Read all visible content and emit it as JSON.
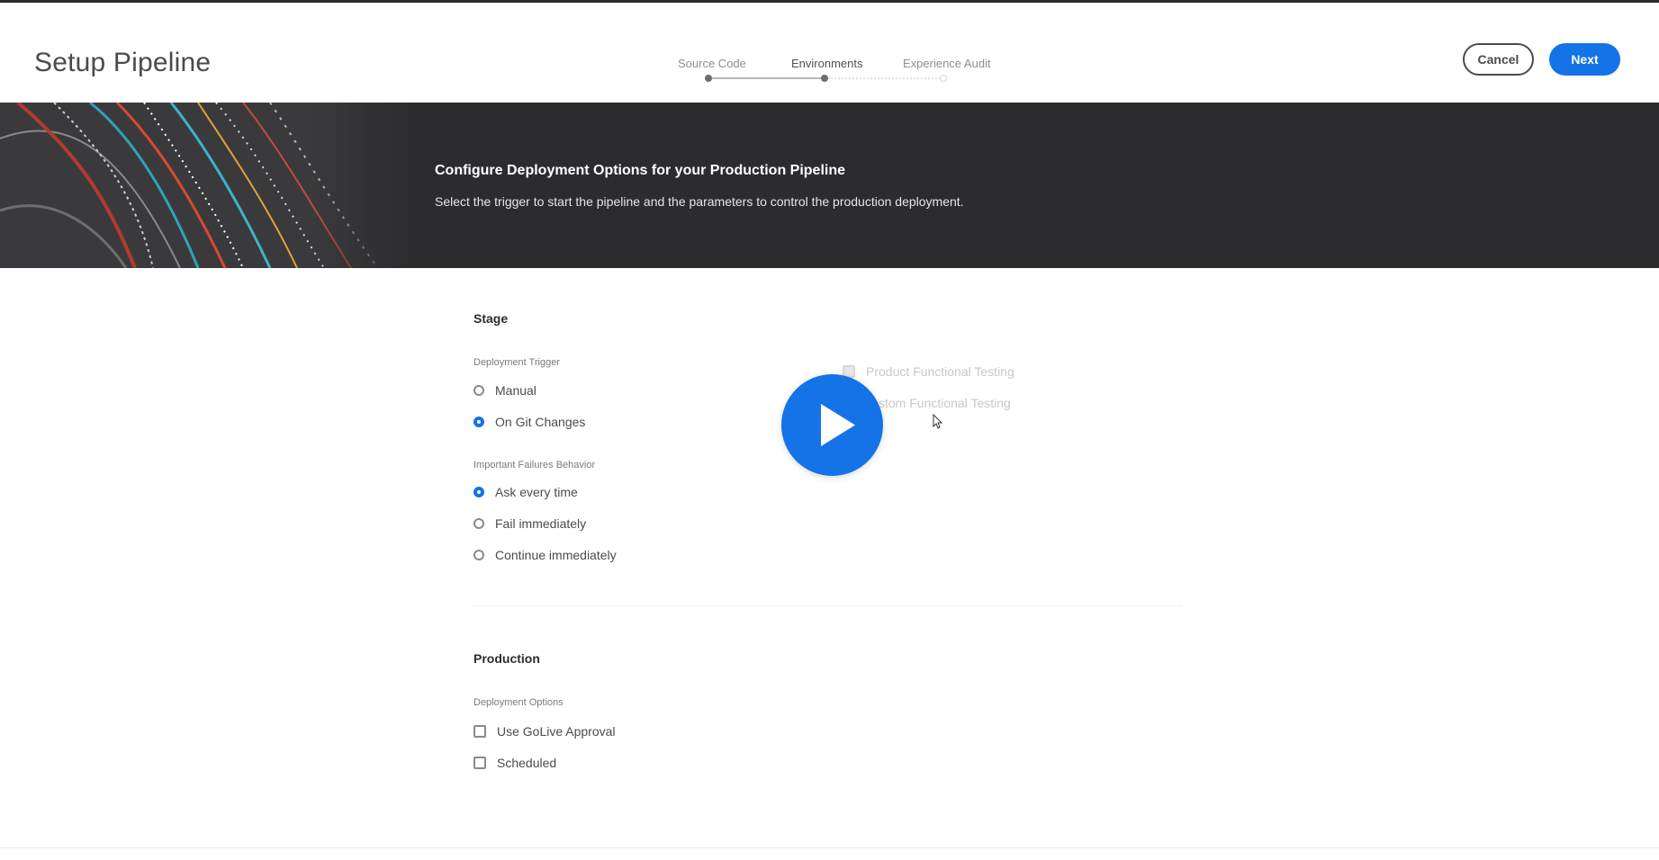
{
  "header": {
    "title": "Setup Pipeline",
    "steps": [
      {
        "label": "Source Code",
        "state": "done"
      },
      {
        "label": "Environments",
        "state": "current"
      },
      {
        "label": "Experience Audit",
        "state": "pending"
      }
    ],
    "cancel_label": "Cancel",
    "next_label": "Next"
  },
  "banner": {
    "title": "Configure Deployment Options for your Production Pipeline",
    "subtitle": "Select the trigger to start the pipeline and the parameters to control the production deployment."
  },
  "stage": {
    "title": "Stage",
    "trigger_label": "Deployment Trigger",
    "triggers": [
      {
        "label": "Manual",
        "checked": false
      },
      {
        "label": "On Git Changes",
        "checked": true
      }
    ],
    "failures_label": "Important Failures Behavior",
    "failures": [
      {
        "label": "Ask every time",
        "checked": true
      },
      {
        "label": "Fail immediately",
        "checked": false
      },
      {
        "label": "Continue immediately",
        "checked": false
      }
    ],
    "testing": [
      {
        "label": "Product Functional Testing",
        "checked": true
      },
      {
        "label": "stom Functional Testing",
        "checked": false
      }
    ]
  },
  "production": {
    "title": "Production",
    "options_label": "Deployment Options",
    "options": [
      {
        "label": "Use GoLive Approval",
        "checked": false
      },
      {
        "label": "Scheduled",
        "checked": false
      }
    ]
  },
  "colors": {
    "accent": "#1473e6",
    "banner": "#2c2b2e"
  },
  "icons": {
    "play": "play-icon",
    "cursor": "mouse-pointer-icon"
  }
}
